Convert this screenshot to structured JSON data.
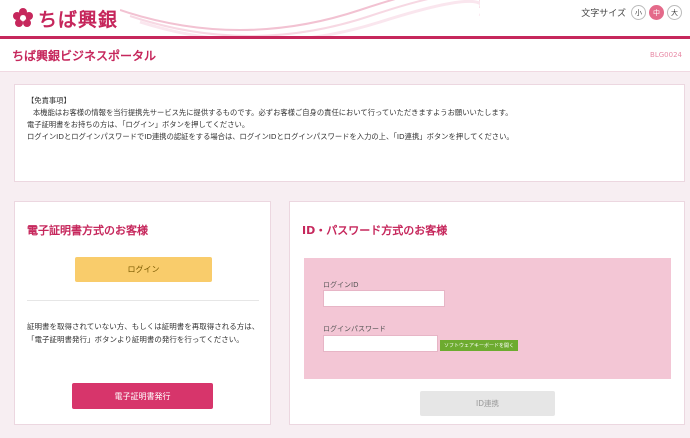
{
  "header": {
    "logo_text": "ちば興銀",
    "fontsize_label": "文字サイズ",
    "fontsize_options": [
      "小",
      "中",
      "大"
    ],
    "fontsize_selected": "中",
    "colors": {
      "brand": "#c6275c",
      "accent": "#e46a8a"
    }
  },
  "titlebar": {
    "title": "ちば興銀ビジネスポータル",
    "code": "BLG0024"
  },
  "notice": {
    "lines": [
      "【免責事項】",
      "本機能はお客様の情報を当行提携先サービス先に提供するものです。必ずお客様ご自身の責任において行っていただきますようお願いいたします。",
      "電子証明書をお持ちの方は、「ログイン」ボタンを押してください。",
      "ログインIDとログインパスワードでID連携の認証をする場合は、ログインIDとログインパスワードを入力の上、「ID連携」ボタンを押してください。"
    ]
  },
  "left_card": {
    "title": "電子証明書方式のお客様",
    "login_label": "ログイン",
    "description": "証明書を取得されていない方、もしくは証明書を再取得される方は、「電子証明書発行」ボタンより証明書の発行を行ってください。",
    "cert_button_label": "電子証明書発行"
  },
  "right_card": {
    "title": "ID・パスワード方式のお客様",
    "login_id_label": "ログインID",
    "login_id_value": "",
    "password_label": "ログインパスワード",
    "password_value": "",
    "software_keyboard_label": "ソフトウェアキーボードを開く",
    "id_link_button_label": "ID連携"
  }
}
